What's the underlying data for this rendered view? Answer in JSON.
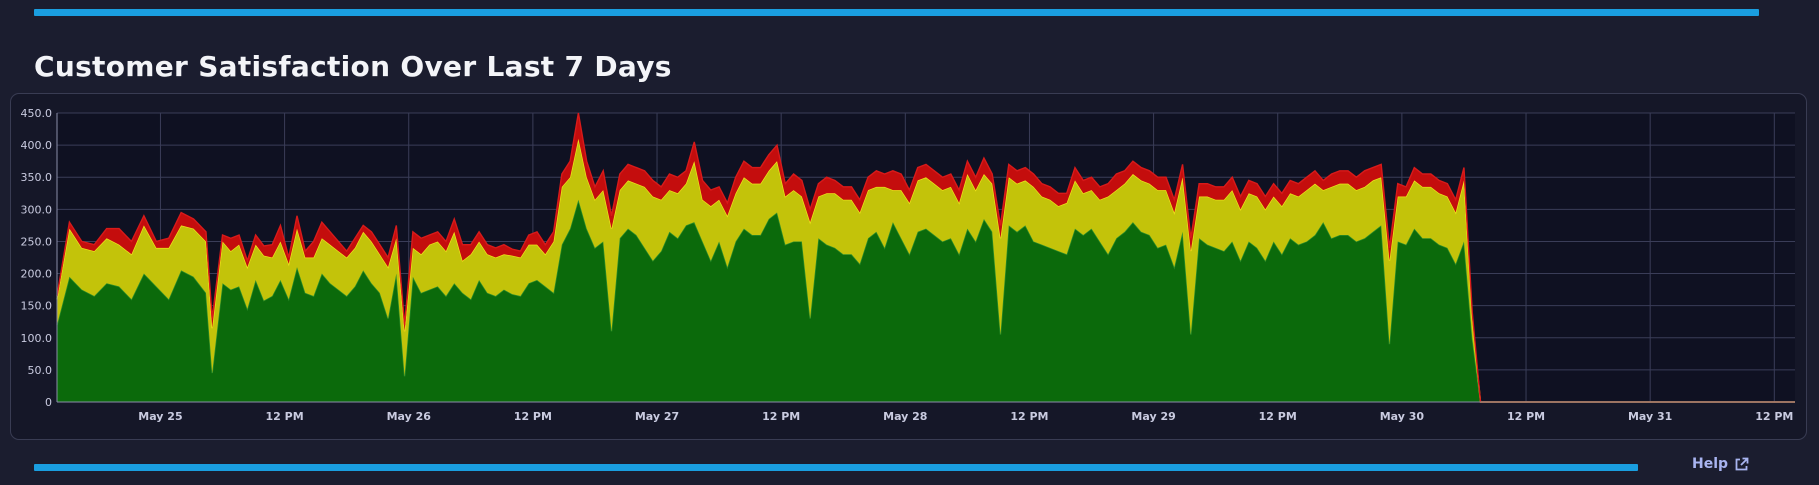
{
  "title": "Customer Satisfaction Over Last 7 Days",
  "help_label": "Help",
  "icons": {
    "external": "external-link-icon"
  },
  "colors": {
    "accent": "#1a9ee0",
    "background": "#1b1d2f",
    "plot_background": "#0f1122",
    "satisfied": "#0b6a0b",
    "tolerating": "#c3c30a",
    "frustrated": "#c40d0d"
  },
  "chart_data": {
    "type": "area",
    "stacked": true,
    "title": "Customer Satisfaction Over Last 7 Days",
    "xlabel": "",
    "ylabel": "",
    "xlim": [
      0,
      168
    ],
    "ylim": [
      0,
      450
    ],
    "grid": true,
    "y_ticks": [
      0,
      50,
      100,
      150,
      200,
      250,
      300,
      350,
      400,
      450
    ],
    "y_tick_labels": [
      "0",
      "50.0",
      "100.0",
      "150.0",
      "200.0",
      "250.0",
      "300.0",
      "350.0",
      "400.0",
      "450.0"
    ],
    "x_ticks": [
      {
        "x": 10,
        "label": "May 25"
      },
      {
        "x": 22,
        "label": "12 PM"
      },
      {
        "x": 34,
        "label": "May 26"
      },
      {
        "x": 46,
        "label": "12 PM"
      },
      {
        "x": 58,
        "label": "May 27"
      },
      {
        "x": 70,
        "label": "12 PM"
      },
      {
        "x": 82,
        "label": "May 28"
      },
      {
        "x": 94,
        "label": "12 PM"
      },
      {
        "x": 106,
        "label": "May 29"
      },
      {
        "x": 118,
        "label": "12 PM"
      },
      {
        "x": 130,
        "label": "May 30"
      },
      {
        "x": 142,
        "label": "12 PM"
      },
      {
        "x": 154,
        "label": "May 31"
      },
      {
        "x": 166,
        "label": "12 PM"
      }
    ],
    "x_points": [
      0,
      1.2,
      2.4,
      3.6,
      4.8,
      6.0,
      7.2,
      8.4,
      9.6,
      10.8,
      12.0,
      13.2,
      14.4,
      15.0,
      16.0,
      16.8,
      17.6,
      18.4,
      19.2,
      20.0,
      20.8,
      21.6,
      22.4,
      23.2,
      24.0,
      24.8,
      25.6,
      26.4,
      27.2,
      28.0,
      28.8,
      29.6,
      30.4,
      31.2,
      32.0,
      32.8,
      33.6,
      34.4,
      35.2,
      36.0,
      36.8,
      37.6,
      38.4,
      39.2,
      40.0,
      40.8,
      41.6,
      42.4,
      43.2,
      44.0,
      44.8,
      45.6,
      46.4,
      47.2,
      48.0,
      48.8,
      49.6,
      50.4,
      51.2,
      52.0,
      52.8,
      53.6,
      54.4,
      55.2,
      56.0,
      56.8,
      57.6,
      58.4,
      59.2,
      60.0,
      60.8,
      61.6,
      62.4,
      63.2,
      64.0,
      64.8,
      65.6,
      66.4,
      67.2,
      68.0,
      68.8,
      69.6,
      70.4,
      71.2,
      72.0,
      72.8,
      73.6,
      74.4,
      75.2,
      76.0,
      76.8,
      77.6,
      78.4,
      79.2,
      80.0,
      80.8,
      81.6,
      82.4,
      83.2,
      84.0,
      84.8,
      85.6,
      86.4,
      87.2,
      88.0,
      88.8,
      89.6,
      90.4,
      91.2,
      92.0,
      92.8,
      93.6,
      94.4,
      95.2,
      96.0,
      96.8,
      97.6,
      98.4,
      99.2,
      100.0,
      100.8,
      101.6,
      102.4,
      103.2,
      104.0,
      104.8,
      105.6,
      106.4,
      107.2,
      108.0,
      108.8,
      109.6,
      110.4,
      111.2,
      112.0,
      112.8,
      113.6,
      114.4,
      115.2,
      116.0,
      116.8,
      117.6,
      118.4,
      119.2,
      120.0,
      120.8,
      121.6,
      122.4,
      123.2,
      124.0,
      124.8,
      125.6,
      126.4,
      127.2,
      128.0,
      128.8,
      129.6,
      130.4,
      131.2,
      132.0,
      132.8,
      133.6,
      134.4,
      135.2,
      136.0,
      136.8,
      137.6,
      138.4,
      139.2,
      140.0,
      140.8,
      141.6,
      142.4,
      143.2,
      144.0,
      144.8,
      145.6,
      146.4,
      147.2,
      148.0,
      148.8,
      149.6,
      150.4,
      151.2,
      152.0,
      152.8,
      153.6,
      154.4,
      155.2,
      156.0,
      156.8,
      157.6,
      158.4,
      159.2,
      160.0,
      160.8,
      161.6,
      162.4,
      163.2,
      164.0,
      164.8,
      165.6,
      166.4,
      167.2,
      168.0
    ],
    "series": [
      {
        "color": "#0b6a0b",
        "values": [
          120,
          195,
          175,
          165,
          185,
          180,
          160,
          200,
          180,
          160,
          205,
          195,
          170,
          45,
          185,
          175,
          180,
          145,
          190,
          158,
          165,
          190,
          160,
          210,
          170,
          165,
          200,
          185,
          175,
          165,
          180,
          205,
          185,
          170,
          130,
          200,
          40,
          195,
          170,
          175,
          180,
          165,
          185,
          170,
          160,
          190,
          170,
          165,
          175,
          168,
          165,
          185,
          190,
          180,
          170,
          245,
          270,
          315,
          270,
          240,
          250,
          110,
          255,
          270,
          260,
          240,
          220,
          235,
          265,
          255,
          275,
          280,
          250,
          220,
          250,
          210,
          250,
          270,
          260,
          260,
          285,
          295,
          245,
          250,
          250,
          130,
          255,
          245,
          240,
          230,
          230,
          215,
          255,
          265,
          240,
          280,
          255,
          230,
          265,
          270,
          260,
          250,
          255,
          230,
          270,
          250,
          285,
          265,
          105,
          275,
          265,
          275,
          250,
          245,
          240,
          235,
          230,
          270,
          260,
          270,
          250,
          230,
          255,
          265,
          280,
          265,
          260,
          240,
          245,
          210,
          265,
          105,
          255,
          245,
          240,
          235,
          250,
          220,
          250,
          240,
          220,
          250,
          230,
          255,
          245,
          250,
          260,
          280,
          255,
          260,
          260,
          250,
          255,
          265,
          275,
          90,
          250,
          245,
          270,
          255,
          255,
          245,
          240,
          215,
          250,
          100
        ],
        "name": ""
      },
      {
        "color": "#c3c30a",
        "values": [
          40,
          75,
          65,
          70,
          70,
          65,
          70,
          75,
          60,
          80,
          70,
          75,
          80,
          70,
          65,
          60,
          65,
          65,
          55,
          70,
          60,
          60,
          55,
          60,
          55,
          60,
          55,
          60,
          60,
          60,
          60,
          60,
          65,
          60,
          80,
          55,
          70,
          45,
          60,
          70,
          70,
          70,
          80,
          50,
          70,
          60,
          60,
          60,
          55,
          60,
          60,
          60,
          55,
          50,
          80,
          90,
          80,
          95,
          80,
          75,
          80,
          160,
          75,
          75,
          80,
          95,
          100,
          80,
          65,
          70,
          65,
          95,
          65,
          85,
          65,
          80,
          75,
          80,
          80,
          80,
          75,
          80,
          75,
          80,
          70,
          150,
          65,
          80,
          85,
          85,
          85,
          80,
          75,
          70,
          95,
          50,
          75,
          80,
          80,
          80,
          80,
          80,
          80,
          80,
          85,
          80,
          70,
          75,
          150,
          75,
          75,
          70,
          85,
          75,
          75,
          70,
          80,
          75,
          65,
          60,
          65,
          90,
          75,
          75,
          75,
          80,
          80,
          90,
          85,
          85,
          85,
          130,
          65,
          75,
          75,
          80,
          80,
          80,
          75,
          80,
          80,
          70,
          75,
          70,
          75,
          80,
          80,
          50,
          80,
          80,
          80,
          80,
          80,
          80,
          75,
          130,
          70,
          75,
          75,
          80,
          80,
          80,
          80,
          80,
          95,
          30
        ],
        "name": ""
      },
      {
        "color": "#c40d0d",
        "values": [
          5,
          10,
          10,
          10,
          15,
          25,
          20,
          15,
          10,
          15,
          20,
          15,
          15,
          15,
          10,
          20,
          15,
          10,
          15,
          15,
          20,
          25,
          10,
          20,
          10,
          25,
          25,
          20,
          15,
          10,
          15,
          10,
          15,
          15,
          15,
          20,
          10,
          25,
          25,
          15,
          15,
          15,
          20,
          25,
          15,
          15,
          15,
          15,
          15,
          10,
          10,
          15,
          20,
          15,
          15,
          20,
          25,
          40,
          25,
          20,
          30,
          20,
          25,
          25,
          25,
          25,
          25,
          20,
          25,
          25,
          20,
          30,
          30,
          25,
          20,
          20,
          25,
          25,
          25,
          25,
          25,
          25,
          20,
          25,
          25,
          20,
          20,
          25,
          20,
          20,
          20,
          20,
          20,
          25,
          20,
          30,
          25,
          20,
          20,
          20,
          20,
          20,
          20,
          20,
          20,
          20,
          25,
          15,
          20,
          20,
          20,
          20,
          20,
          20,
          20,
          20,
          15,
          20,
          20,
          20,
          20,
          20,
          25,
          20,
          20,
          20,
          20,
          20,
          20,
          20,
          20,
          20,
          20,
          20,
          20,
          20,
          20,
          20,
          20,
          20,
          20,
          20,
          20,
          20,
          20,
          20,
          20,
          15,
          20,
          20,
          20,
          20,
          25,
          20,
          20,
          20,
          20,
          15,
          20,
          20,
          20,
          20,
          20,
          20,
          20,
          10
        ],
        "name": ""
      }
    ]
  }
}
